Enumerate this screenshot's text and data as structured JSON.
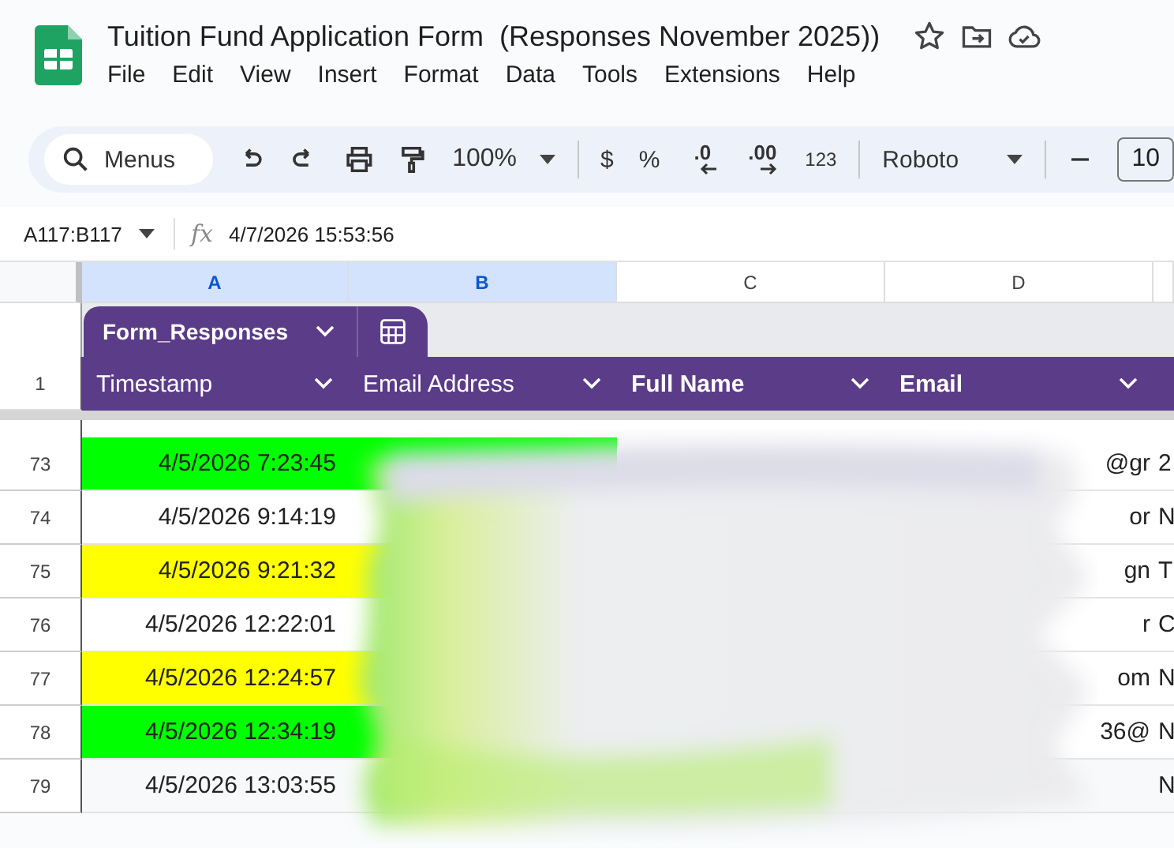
{
  "document": {
    "title": "Tuition Fund Application Form  (Responses November 2025))"
  },
  "menu": [
    "File",
    "Edit",
    "View",
    "Insert",
    "Format",
    "Data",
    "Tools",
    "Extensions",
    "Help"
  ],
  "toolbar": {
    "search": "Menus",
    "zoom": "100%",
    "currency": "$",
    "percent": "%",
    "decrease_decimal": ".0",
    "increase_decimal": ".00",
    "number_format": "123",
    "font": "Roboto",
    "font_size": "10"
  },
  "formula_bar": {
    "cell_range": "A117:B117",
    "formula_icon": "fx",
    "value": "4/7/2026 15:53:56"
  },
  "columns": [
    {
      "letter": "A",
      "selected": true
    },
    {
      "letter": "B",
      "selected": true
    },
    {
      "letter": "C",
      "selected": false
    },
    {
      "letter": "D",
      "selected": false
    }
  ],
  "table": {
    "name": "Form_Responses",
    "header_row_number": "1",
    "headers": [
      {
        "label": "Timestamp",
        "bold": false
      },
      {
        "label": "Email Address",
        "bold": false
      },
      {
        "label": "Full Name",
        "bold": true
      },
      {
        "label": "Email",
        "bold": true
      }
    ],
    "rows": [
      {
        "number": "73",
        "timestamp": "4/5/2026 7:23:45",
        "color": "#00ff00",
        "column_d": "@gr",
        "column_e": "2"
      },
      {
        "number": "74",
        "timestamp": "4/5/2026 9:14:19",
        "color": "#ffffff",
        "column_d": "or",
        "column_e": "N"
      },
      {
        "number": "75",
        "timestamp": "4/5/2026 9:21:32",
        "color": "#ffff00",
        "column_d": "gn",
        "column_e": "T"
      },
      {
        "number": "76",
        "timestamp": "4/5/2026 12:22:01",
        "color": "#ffffff",
        "column_d": "r",
        "column_e": "C"
      },
      {
        "number": "77",
        "timestamp": "4/5/2026 12:24:57",
        "color": "#ffff00",
        "column_d": "om",
        "column_e": "N"
      },
      {
        "number": "78",
        "timestamp": "4/5/2026 12:34:19",
        "color": "#00ff00",
        "column_d": "36@",
        "column_e": "N"
      },
      {
        "number": "79",
        "timestamp": "4/5/2026 13:03:55",
        "color": "#f8f9fa",
        "column_e": "N"
      }
    ]
  }
}
